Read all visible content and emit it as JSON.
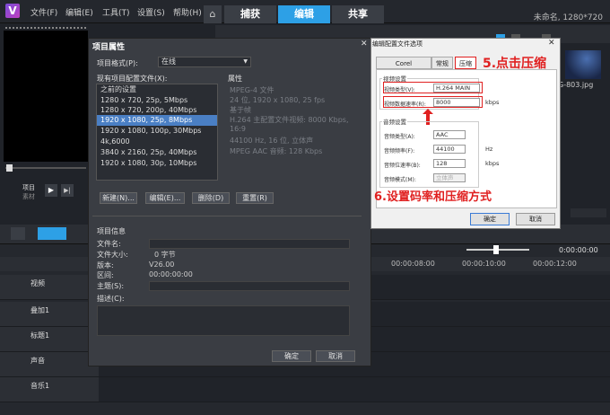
{
  "menu": {
    "file": "文件(F)",
    "edit": "编辑(E)",
    "tools": "工具(T)",
    "settings": "设置(S)",
    "help": "帮助(H)"
  },
  "tabs": {
    "capture": "捕获",
    "edit": "编辑",
    "share": "共享"
  },
  "project_title": "未命名, 1280*720",
  "preview": {
    "project_label": "项目",
    "clip_label": "素材"
  },
  "library": {
    "thumb_name": "G-803.jpg"
  },
  "timeline": {
    "ruler": [
      "00:00:08:00",
      "00:00:10:00",
      "00:00:12:00"
    ],
    "timecode": "0:00:00:00",
    "tracks": [
      "视频",
      "叠加1",
      "标题1",
      "声音",
      "音乐1"
    ]
  },
  "project_dialog": {
    "title": "项目属性",
    "format_label": "项目格式(P):",
    "format_value": "在线",
    "profiles_label": "现有项目配置文件(X):",
    "props_label": "属性",
    "profiles": [
      "之前的设置",
      "1280 x 720, 25p, 5Mbps",
      "1280 x 720, 200p, 40Mbps",
      "1920 x 1080, 25p, 8Mbps",
      "1920 x 1080, 100p, 30Mbps",
      "4k,6000",
      "3840 x 2160, 25p, 40Mbps",
      "1920 x 1080, 30p, 10Mbps"
    ],
    "props": [
      "MPEG-4 文件",
      "24 位, 1920 x 1080, 25 fps",
      "基于帧",
      "H.264 主配置文件视频: 8000 Kbps, 16:9",
      "44100 Hz, 16 位, 立体声",
      "MPEG AAC 音频: 128 Kbps"
    ],
    "btn_new": "新建(N)...",
    "btn_edit": "编辑(E)...",
    "btn_delete": "删除(D)",
    "btn_reset": "重置(R)",
    "info_title": "项目信息",
    "info_filename": "文件名:",
    "info_filesize": "文件大小:",
    "info_filesize_val": "0 字节",
    "info_version": "版本:",
    "info_version_val": "V26.00",
    "info_range": "区间:",
    "info_range_val": "00:00:00:00",
    "info_subject": "主题(S):",
    "info_desc": "描述(C):",
    "ok": "确定",
    "cancel": "取消"
  },
  "encoder_dialog": {
    "title": "编辑配置文件选项",
    "tabs": [
      "Corel VideoStudio",
      "常规",
      "压缩"
    ],
    "video_group": "视频设置",
    "video_type_label": "视频类型(V):",
    "video_type": "H.264 MAIN",
    "video_bitrate_label": "视频数据速率(R):",
    "video_bitrate": "8000",
    "kbps": "kbps",
    "audio_group": "音频设置",
    "audio_type_label": "音频类型(A):",
    "audio_type": "AAC",
    "audio_freq_label": "音频频率(F):",
    "audio_freq": "44100",
    "hz": "Hz",
    "audio_bitrate_label": "音频位速率(B):",
    "audio_bitrate": "128",
    "audio_mode_label": "音频模式(M):",
    "audio_mode": "立体声",
    "ok": "确定",
    "cancel": "取消"
  },
  "annotations": {
    "step5": "5.点击压缩",
    "step6": "6.设置码率和压缩方式"
  },
  "colors": {
    "accent": "#2da0e6",
    "annotation": "#e02020"
  }
}
